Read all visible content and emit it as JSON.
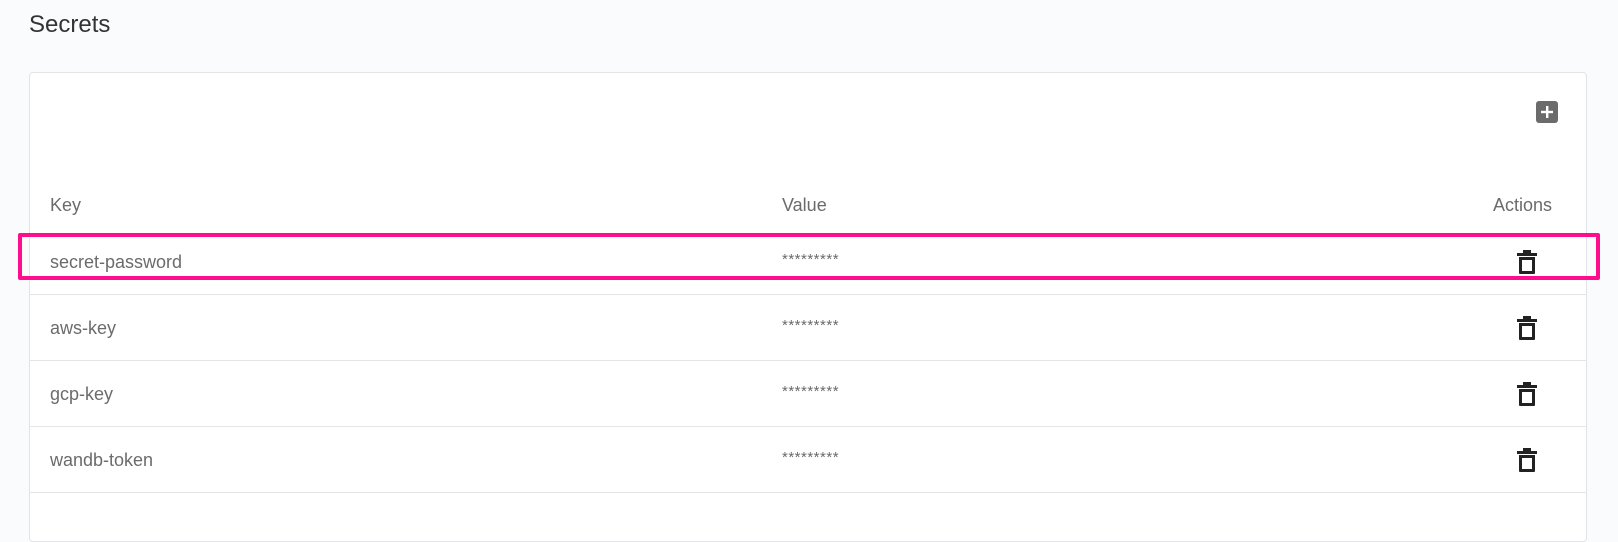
{
  "page": {
    "title": "Secrets"
  },
  "toolbar": {
    "add_icon": "plus-square-icon"
  },
  "table": {
    "columns": {
      "key": "Key",
      "value": "Value",
      "actions": "Actions"
    },
    "rows": [
      {
        "key": "secret-password",
        "value": "*********",
        "action_icon": "trash-icon"
      },
      {
        "key": "aws-key",
        "value": "*********",
        "action_icon": "trash-icon"
      },
      {
        "key": "gcp-key",
        "value": "*********",
        "action_icon": "trash-icon"
      },
      {
        "key": "wandb-token",
        "value": "*********",
        "action_icon": "trash-icon"
      }
    ]
  },
  "colors": {
    "highlight": "#ff0d8c",
    "text": "#6b6b6b",
    "title": "#333333",
    "icon": "#222222"
  }
}
